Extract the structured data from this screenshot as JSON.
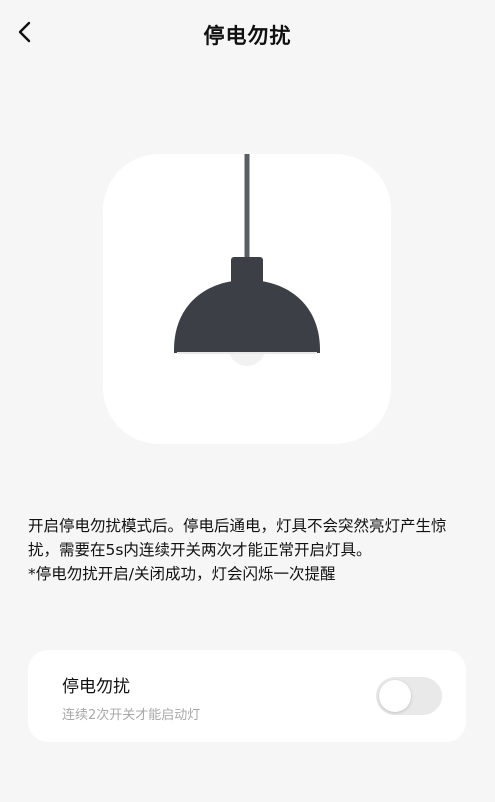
{
  "header": {
    "title": "停电勿扰",
    "back_icon": "chevron-left-icon"
  },
  "illustration": {
    "icon": "pendant-lamp-icon",
    "colors": {
      "shade": "#3c4046",
      "cord": "#5a5e64",
      "bulb": "#f2f2f2"
    }
  },
  "description": {
    "paragraph": "开启停电勿扰模式后。停电后通电，灯具不会突然亮灯产生惊扰，需要在5s内连续开关两次才能正常开启灯具。",
    "note": "*停电勿扰开启/关闭成功，灯会闪烁一次提醒"
  },
  "setting": {
    "title": "停电勿扰",
    "subtitle": "连续2次开关才能启动灯",
    "toggle_on": false,
    "toggle_off_color": "#e9e9e9"
  }
}
